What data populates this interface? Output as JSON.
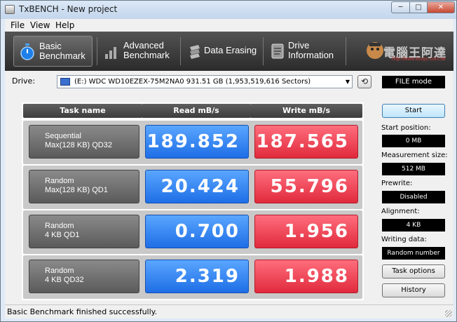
{
  "window": {
    "title": "TxBENCH - New project",
    "min": "─",
    "max": "□",
    "close": "✕"
  },
  "menu": [
    "File",
    "View",
    "Help"
  ],
  "toolbar": {
    "tabs": [
      {
        "line1": "Basic",
        "line2": "Benchmark"
      },
      {
        "line1": "Advanced",
        "line2": "Benchmark"
      },
      {
        "line1": "Data Erasing",
        "line2": ""
      },
      {
        "line1": "Drive",
        "line2": "Information"
      }
    ],
    "active_tab": 0,
    "logo_text": "電腦王阿達",
    "logo_sub": "http://www.kocpc.com.tw",
    "icons": [
      "stopwatch-icon",
      "bar-chart-icon",
      "eraser-icon",
      "drive-info-icon"
    ]
  },
  "drive": {
    "label": "Drive:",
    "selected": "(E:) WDC WD10EZEX-75M2NA0  931.51 GB (1,953,519,616 Sectors)",
    "refresh_symbol": "⟲",
    "mode": "FILE mode"
  },
  "table": {
    "headers": [
      "Task name",
      "Read mB/s",
      "Write mB/s"
    ],
    "rows": [
      {
        "name1": "Sequential",
        "name2": "Max(128 KB) QD32",
        "read": "189.852",
        "write": "187.565"
      },
      {
        "name1": "Random",
        "name2": "Max(128 KB) QD1",
        "read": "20.424",
        "write": "55.796"
      },
      {
        "name1": "Random",
        "name2": "4 KB QD1",
        "read": "0.700",
        "write": "1.956"
      },
      {
        "name1": "Random",
        "name2": "4 KB QD32",
        "read": "2.319",
        "write": "1.988"
      }
    ]
  },
  "settings": {
    "start_label": "Start",
    "start_position_label": "Start position:",
    "start_position": "0 MB",
    "measurement_size_label": "Measurement size:",
    "measurement_size": "512 MB",
    "prewrite_label": "Prewrite:",
    "prewrite": "Disabled",
    "alignment_label": "Alignment:",
    "alignment": "4 KB",
    "writing_data_label": "Writing data:",
    "writing_data": "Random number",
    "task_options_label": "Task options",
    "history_label": "History"
  },
  "status": "Basic Benchmark finished successfully."
}
